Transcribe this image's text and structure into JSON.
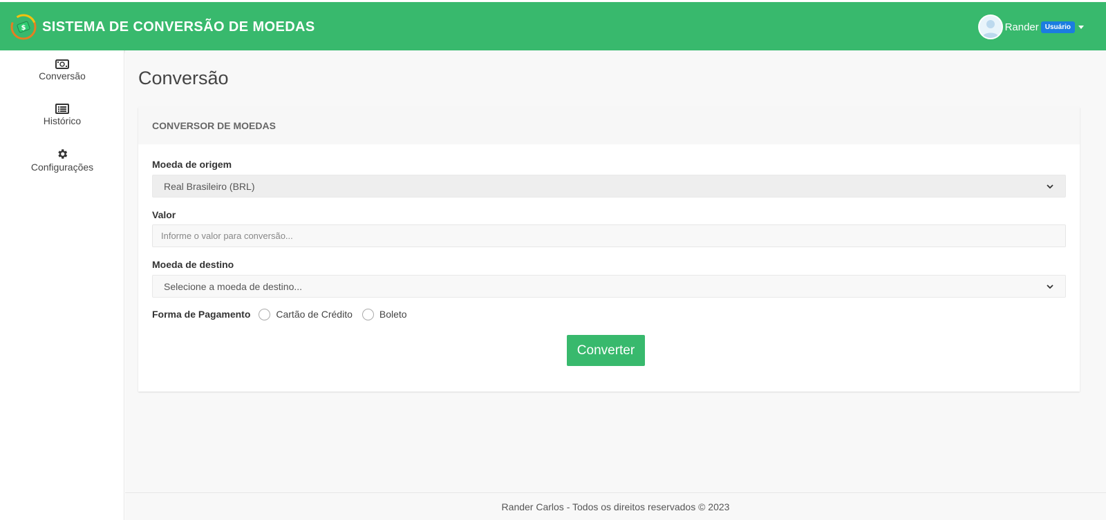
{
  "header": {
    "app_title": "SISTEMA DE CONVERSÃO DE MOEDAS",
    "user_name": "Rander",
    "user_role": "Usuário"
  },
  "sidebar": {
    "items": [
      {
        "label": "Conversão",
        "icon": "money-bill-icon"
      },
      {
        "label": "Histórico",
        "icon": "list-icon"
      },
      {
        "label": "Configurações",
        "icon": "gear-icon"
      }
    ]
  },
  "main": {
    "page_title": "Conversão",
    "card_title": "CONVERSOR DE MOEDAS",
    "form": {
      "origin_label": "Moeda de origem",
      "origin_value": "Real Brasileiro (BRL)",
      "amount_label": "Valor",
      "amount_placeholder": "Informe o valor para conversão...",
      "destination_label": "Moeda de destino",
      "destination_placeholder": "Selecione a moeda de destino...",
      "payment_label": "Forma de Pagamento",
      "payment_options": [
        "Cartão de Crédito",
        "Boleto"
      ],
      "submit_label": "Converter"
    }
  },
  "footer": {
    "text": "Rander Carlos - Todos os direitos reservados © 2023"
  },
  "colors": {
    "primary": "#38b96d",
    "badge": "#1b7de0"
  }
}
